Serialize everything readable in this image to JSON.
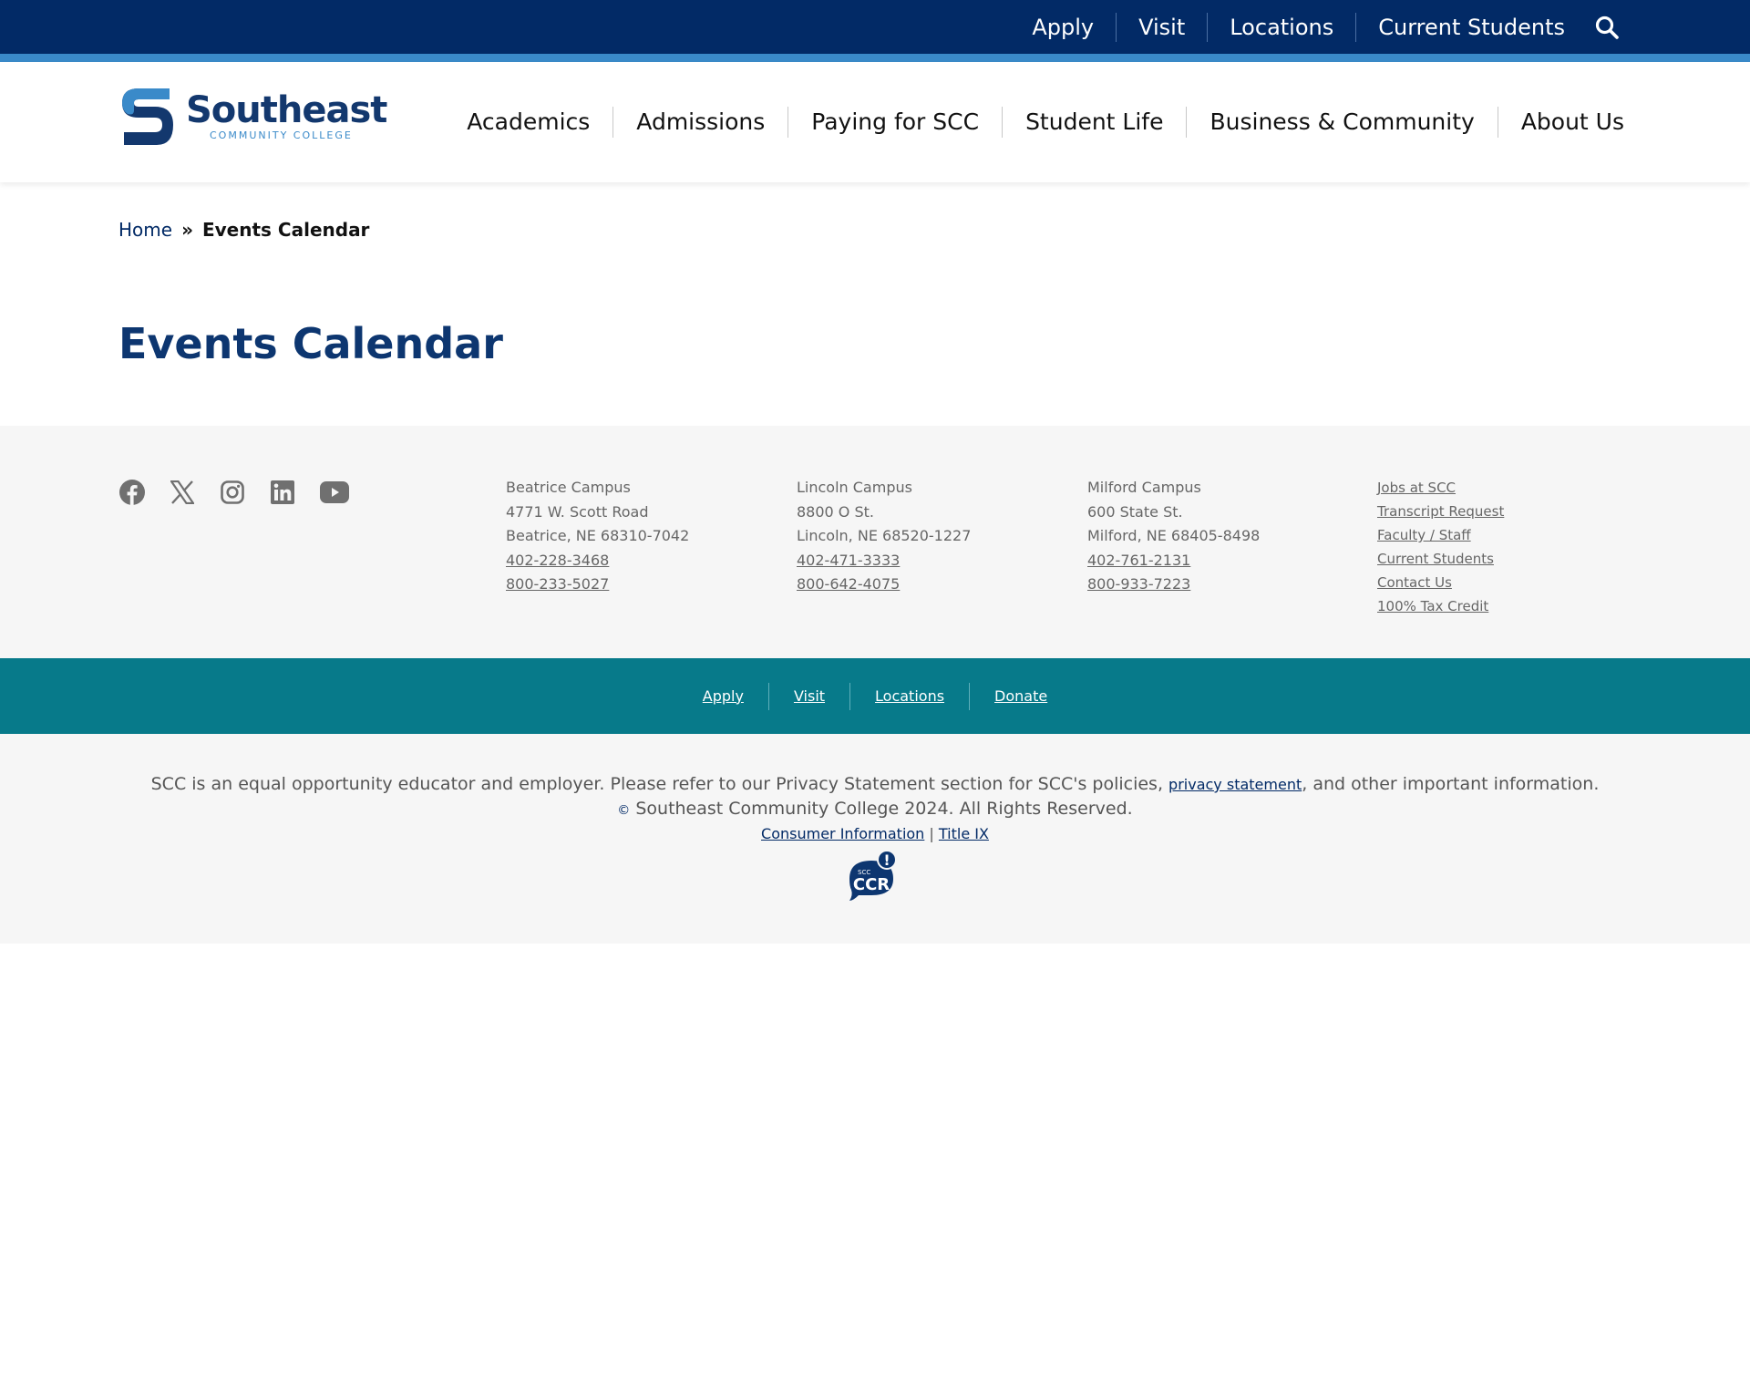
{
  "utility_nav": {
    "items": [
      "Apply",
      "Visit",
      "Locations",
      "Current Students"
    ]
  },
  "logo": {
    "name": "Southeast",
    "subtitle": "COMMUNITY COLLEGE"
  },
  "main_nav": {
    "items": [
      "Academics",
      "Admissions",
      "Paying for SCC",
      "Student Life",
      "Business & Community",
      "About Us"
    ]
  },
  "breadcrumb": {
    "home": "Home",
    "separator": "»",
    "current": "Events Calendar"
  },
  "page_title": "Events Calendar",
  "social": [
    "facebook-icon",
    "x-icon",
    "instagram-icon",
    "linkedin-icon",
    "youtube-icon"
  ],
  "campuses": [
    {
      "name": "Beatrice Campus",
      "address": "4771 W. Scott Road",
      "city": "Beatrice, NE 68310-7042",
      "phone1": "402-228-3468",
      "phone2": "800-233-5027"
    },
    {
      "name": "Lincoln Campus",
      "address": "8800 O St.",
      "city": "Lincoln, NE 68520-1227",
      "phone1": "402-471-3333",
      "phone2": "800-642-4075"
    },
    {
      "name": "Milford Campus",
      "address": "600 State St.",
      "city": "Milford, NE 68405-8498",
      "phone1": "402-761-2131",
      "phone2": "800-933-7223"
    }
  ],
  "quick_links": [
    "Jobs at SCC",
    "Transcript Request",
    "Faculty / Staff",
    "Current Students",
    "Contact Us",
    "100% Tax Credit"
  ],
  "teal_nav": [
    "Apply",
    "Visit",
    "Locations",
    "Donate"
  ],
  "legal": {
    "notice_before": "SCC is an equal opportunity educator and employer. Please refer to our Privacy Statement section for SCC's policies, ",
    "privacy_link": "privacy statement",
    "notice_after": ", and other important information.",
    "copyright_symbol": "©",
    "copyright": " Southeast Community College 2024. All Rights Reserved.",
    "consumer_info": "Consumer Information",
    "link_separator": " | ",
    "title_ix": "Title IX",
    "ccr_small": "SCC",
    "ccr_big": "CCR",
    "ccr_mark": "!"
  },
  "colors": {
    "navy": "#022a66",
    "accent_blue": "#3a8ac9",
    "teal": "#077a8a",
    "footer_gray": "#f6f6f6"
  }
}
